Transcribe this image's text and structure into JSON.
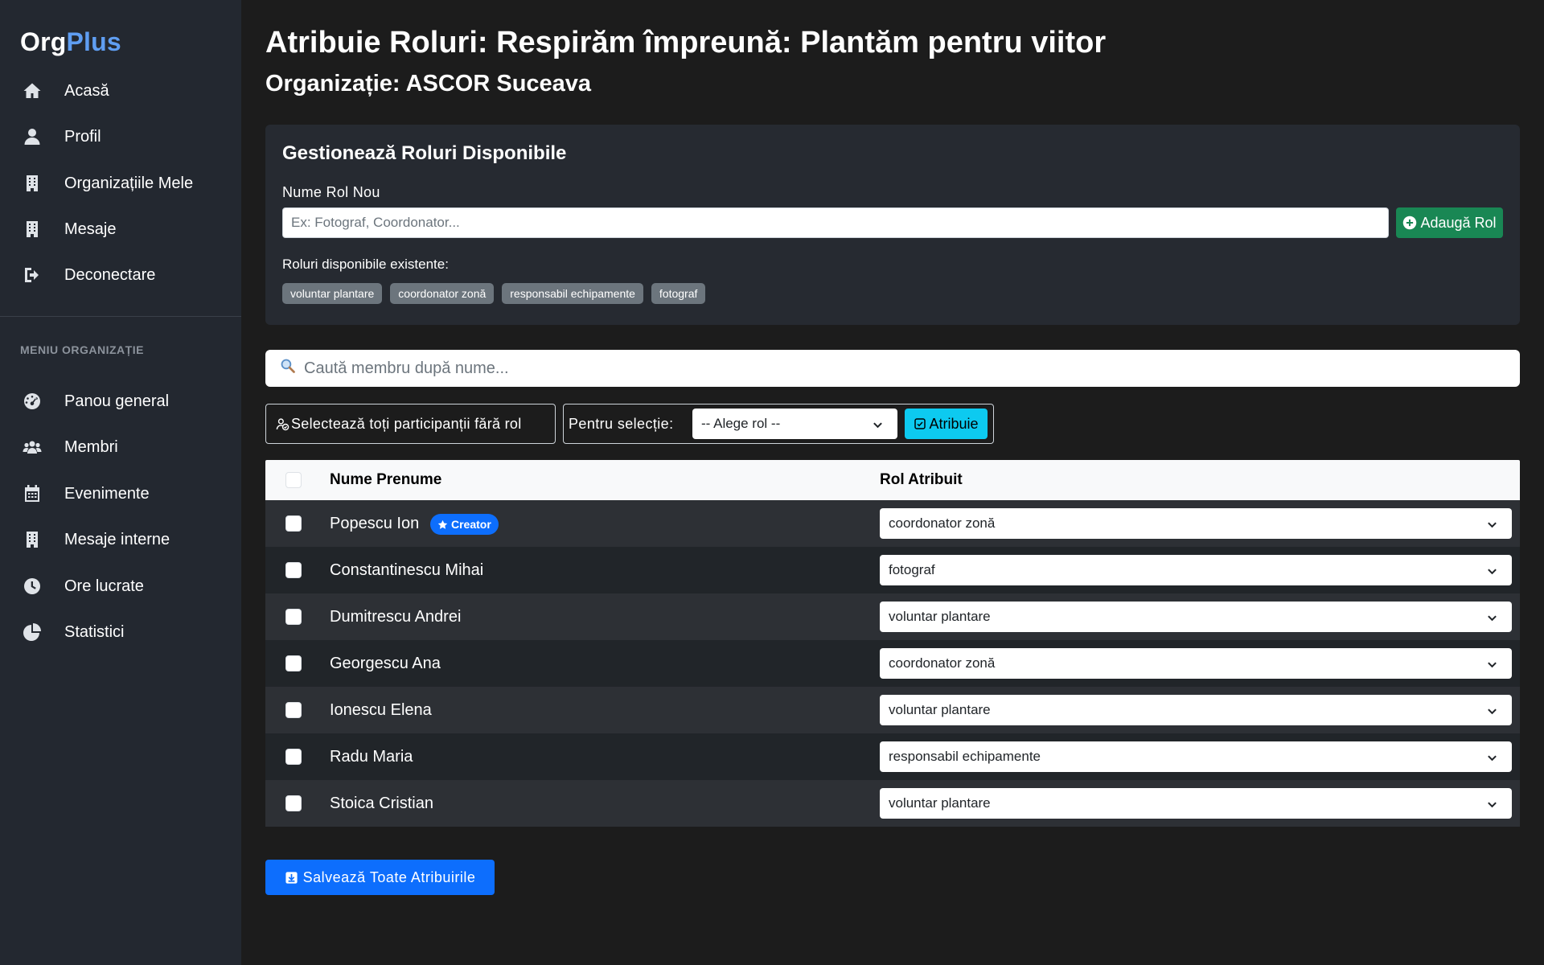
{
  "app": {
    "logo_org": "Org",
    "logo_plus": "Plus"
  },
  "sidebar": {
    "main_items": [
      {
        "label": "Acasă",
        "icon": "home-icon"
      },
      {
        "label": "Profil",
        "icon": "user-icon"
      },
      {
        "label": "Organizațiile Mele",
        "icon": "building-icon"
      },
      {
        "label": "Mesaje",
        "icon": "building-icon"
      },
      {
        "label": "Deconectare",
        "icon": "logout-icon"
      }
    ],
    "section_title": "MENIU ORGANIZAȚIE",
    "org_items": [
      {
        "label": "Panou general",
        "icon": "dashboard-icon"
      },
      {
        "label": "Membri",
        "icon": "users-icon"
      },
      {
        "label": "Evenimente",
        "icon": "calendar-icon"
      },
      {
        "label": "Mesaje interne",
        "icon": "building-icon"
      },
      {
        "label": "Ore lucrate",
        "icon": "clock-icon"
      },
      {
        "label": "Statistici",
        "icon": "pie-chart-icon"
      }
    ]
  },
  "header": {
    "title": "Atribuie Roluri: Respirăm împreună: Plantăm pentru viitor",
    "subtitle": "Organizație: ASCOR Suceava"
  },
  "roles_card": {
    "title": "Gestionează Roluri Disponibile",
    "new_role_label": "Nume Rol Nou",
    "new_role_placeholder": "Ex: Fotograf, Coordonator...",
    "new_role_value": "",
    "add_button": "Adaugă Rol",
    "existing_label": "Roluri disponibile existente:",
    "existing_roles": [
      "voluntar plantare",
      "coordonator zonă",
      "responsabil echipamente",
      "fotograf"
    ]
  },
  "search": {
    "placeholder": "Caută membru după nume...",
    "icon": "magnifier-icon"
  },
  "bulk": {
    "select_all_label": "Selectează toți participanții fără rol",
    "for_selection_label": "Pentru selecție:",
    "role_select_value": "-- Alege rol --",
    "assign_button": "Atribuie"
  },
  "table": {
    "columns": [
      "Nume Prenume",
      "Rol Atribuit"
    ],
    "creator_badge": "Creator",
    "rows": [
      {
        "name": "Popescu Ion",
        "role": "coordonator zonă",
        "creator": true,
        "checked": false
      },
      {
        "name": "Constantinescu Mihai",
        "role": "fotograf",
        "creator": false,
        "checked": false
      },
      {
        "name": "Dumitrescu Andrei",
        "role": "voluntar plantare",
        "creator": false,
        "checked": false
      },
      {
        "name": "Georgescu Ana",
        "role": "coordonator zonă",
        "creator": false,
        "checked": false
      },
      {
        "name": "Ionescu Elena",
        "role": "voluntar plantare",
        "creator": false,
        "checked": false
      },
      {
        "name": "Radu Maria",
        "role": "responsabil echipamente",
        "creator": false,
        "checked": false
      },
      {
        "name": "Stoica Cristian",
        "role": "voluntar plantare",
        "creator": false,
        "checked": false
      }
    ]
  },
  "save_button": "Salvează Toate Atribuirile",
  "colors": {
    "accent_blue": "#0d6efd",
    "logo_blue": "#5f9ef2",
    "success_green": "#198754",
    "info_cyan": "#0dcaf0",
    "badge_gray": "#6c757d"
  }
}
